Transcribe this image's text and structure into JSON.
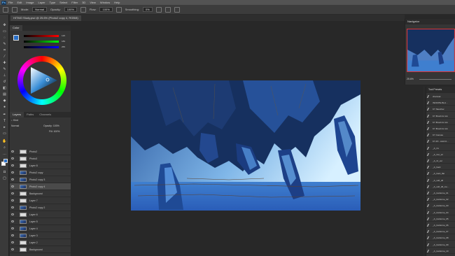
{
  "menubar": {
    "logo": "Ps",
    "items": [
      "File",
      "Edit",
      "Image",
      "Layer",
      "Type",
      "Select",
      "Filter",
      "3D",
      "View",
      "Window",
      "Help"
    ]
  },
  "options": {
    "mode_label": "Mode:",
    "mode_value": "Normal",
    "opacity_label": "Opacity:",
    "opacity_value": "100%",
    "flow_label": "Flow:",
    "flow_value": "100%",
    "smoothing_label": "Smoothing:",
    "smoothing_value": "0%"
  },
  "document": {
    "tab_title": "HITMO Study.psd @ 25.6% (Photo2 copy 4, RGB/8)"
  },
  "color_panel": {
    "tabs": [
      "Color"
    ],
    "values": [
      "126",
      "189",
      "255"
    ],
    "fg_color": "#2a70c8",
    "bg_color": "#ffffff"
  },
  "layers_panel": {
    "tabs": [
      "Layers",
      "Paths",
      "Channels"
    ],
    "kind_label": "Kind",
    "blend_mode": "Normal",
    "opacity_label": "Opacity:",
    "opacity_value": "100%",
    "fill_label": "Fill:",
    "fill_value": "100%",
    "layers": [
      {
        "name": "Photo2",
        "thumb": "white",
        "selected": false
      },
      {
        "name": "Photo3",
        "thumb": "white",
        "selected": false
      },
      {
        "name": "Layer 8",
        "thumb": "white",
        "selected": false
      },
      {
        "name": "Photo2 copy",
        "thumb": "blue",
        "selected": false
      },
      {
        "name": "Photo2 copy 3",
        "thumb": "blue",
        "selected": false
      },
      {
        "name": "Photo2 copy 4",
        "thumb": "blue",
        "selected": true
      },
      {
        "name": "Background",
        "thumb": "white",
        "selected": false
      },
      {
        "name": "Layer 7",
        "thumb": "white",
        "selected": false
      },
      {
        "name": "Photo2 copy 2",
        "thumb": "blue",
        "selected": false
      },
      {
        "name": "Layer 6",
        "thumb": "white",
        "selected": false
      },
      {
        "name": "Layer 5",
        "thumb": "blue",
        "selected": false
      },
      {
        "name": "Layer 4",
        "thumb": "blue",
        "selected": false
      },
      {
        "name": "Layer 3",
        "thumb": "blue",
        "selected": false
      },
      {
        "name": "Layer 2",
        "thumb": "white",
        "selected": false
      },
      {
        "name": "Background",
        "thumb": "white",
        "selected": false
      }
    ]
  },
  "navigator": {
    "title": "Navigator",
    "zoom": "25.6%"
  },
  "tool_presets": {
    "title": "Tool Presets",
    "items": [
      "charcoal",
      "INFINITE BLU...",
      "KY Sketcher",
      "KY Brush for ink",
      "KY Brush for ink",
      "KY Brush for ink",
      "KY Canvas",
      "KY-FX - Add Cl...",
      "_A_Cx",
      "_A_Cut_str",
      "_A_Cl_vel",
      "_A_hard",
      "_A_hard_flat",
      "_A_soft_dif",
      "_A_soft_dif_rou...",
      "_A_lowborne_01",
      "_A_lowborne_02",
      "_A_lowborne_03",
      "_A_lowborne_04",
      "_A_lowborne_05",
      "_A_lowborne_06",
      "_A_lowborne_07",
      "_A_lowborne_08",
      "_A_lowborne_09",
      "_A_lowborne_10"
    ]
  }
}
